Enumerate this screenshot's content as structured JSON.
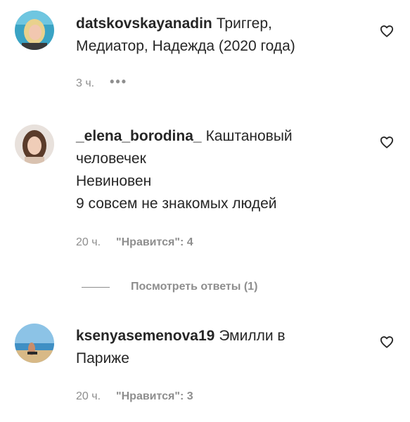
{
  "comments": [
    {
      "username": "datskovskayanadin",
      "lines": [
        "Триггер,",
        "Медиатор, Надежда (2020 года)"
      ],
      "time": "3 ч.",
      "more": "•••"
    },
    {
      "username": "_elena_borodina_",
      "lines": [
        "Каштановый",
        "человечек",
        "Невиновен",
        "9 совсем не знакомых людей"
      ],
      "time": "20 ч.",
      "likes": "\"Нравится\": 4",
      "replies": "Посмотреть ответы (1)"
    },
    {
      "username": "ksenyasemenova19",
      "lines": [
        "Эмилли в",
        "Париже"
      ],
      "time": "20 ч.",
      "likes": "\"Нравится\": 3"
    }
  ],
  "icons": {
    "like": "heart-icon",
    "more": "more-icon"
  },
  "colors": {
    "text": "#262626",
    "secondary": "#8e8e8e",
    "background": "#ffffff"
  }
}
